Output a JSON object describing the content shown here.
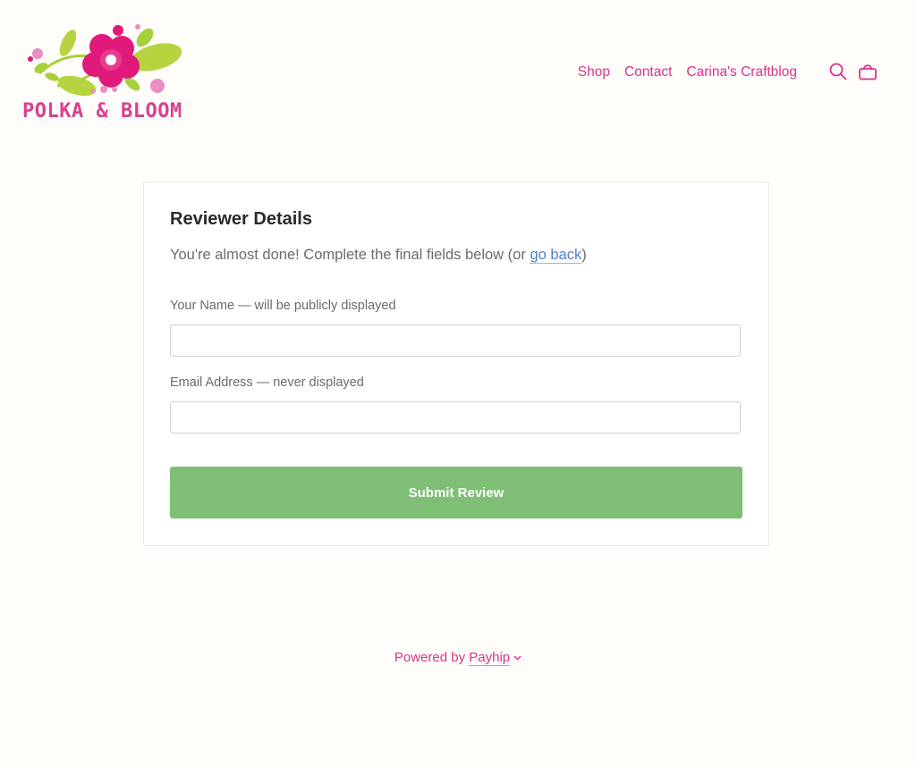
{
  "header": {
    "logo_text": "POLKA & BLOOM",
    "nav": [
      {
        "label": "Shop"
      },
      {
        "label": "Contact"
      },
      {
        "label": "Carina's Craftblog"
      }
    ],
    "icons": {
      "search": "search-icon",
      "cart": "shopping-bag-icon"
    }
  },
  "form": {
    "title": "Reviewer Details",
    "subtitle_prefix": "You're almost done! Complete the final fields below (or ",
    "go_back_label": "go back",
    "subtitle_suffix": ")",
    "name_label": "Your Name — will be publicly displayed",
    "name_value": "",
    "email_label": "Email Address — never displayed",
    "email_value": "",
    "submit_label": "Submit Review"
  },
  "footer": {
    "powered_prefix": "Powered by ",
    "brand": "Payhip",
    "chevron_icon": "chevron-down-icon"
  },
  "colors": {
    "accent_pink": "#d9338c",
    "button_green": "#7ebf75",
    "link_blue": "#4f7fd1",
    "page_bg": "#fefdf9"
  }
}
